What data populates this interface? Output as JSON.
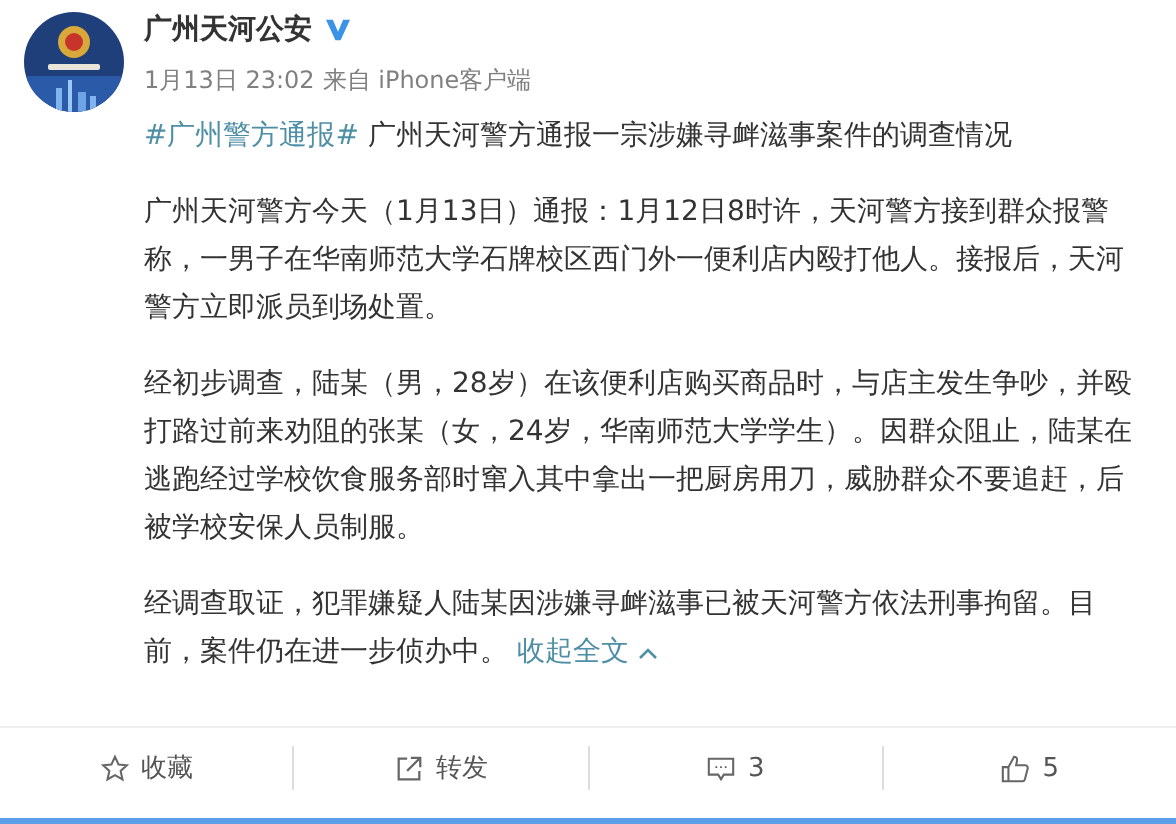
{
  "author": {
    "name": "广州天河公安",
    "verified": true
  },
  "meta": {
    "time": "1月13日 23:02",
    "source": "来自 iPhone客户端"
  },
  "title": {
    "hashtag": "#广州警方通报#",
    "text": " 广州天河警方通报一宗涉嫌寻衅滋事案件的调查情况"
  },
  "paragraphs": [
    "广州天河警方今天（1月13日）通报：1月12日8时许，天河警方接到群众报警称，一男子在华南师范大学石牌校区西门外一便利店内殴打他人。接报后，天河警方立即派员到场处置。",
    "经初步调查，陆某（男，28岁）在该便利店购买商品时，与店主发生争吵，并殴打路过前来劝阻的张某（女，24岁，华南师范大学学生）。因群众阻止，陆某在逃跑经过学校饮食服务部时窜入其中拿出一把厨房用刀，威胁群众不要追赶，后被学校安保人员制服。",
    "经调查取证，犯罪嫌疑人陆某因涉嫌寻衅滋事已被天河警方依法刑事拘留。目前，案件仍在进一步侦办中。"
  ],
  "collapse_link": "收起全文",
  "actions": [
    {
      "kind": "favorite",
      "label": "收藏"
    },
    {
      "kind": "repost",
      "label": "转发"
    },
    {
      "kind": "comment",
      "label": "3"
    },
    {
      "kind": "like",
      "label": "5"
    }
  ]
}
